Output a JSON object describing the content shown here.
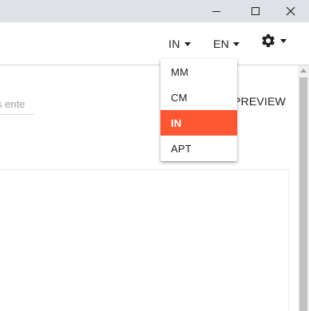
{
  "window": {
    "controls": [
      "minimize",
      "maximize",
      "close"
    ]
  },
  "header": {
    "unit_menu_label": "IN",
    "language_menu_label": "EN",
    "settings_icon": "gear-icon"
  },
  "toolbar": {
    "search_placeholder": "s ente",
    "preview_label": "PREVIEW"
  },
  "unit_dropdown": {
    "selected": "IN",
    "options": [
      {
        "label": "MM",
        "selected": false
      },
      {
        "label": "CM",
        "selected": false
      },
      {
        "label": "IN",
        "selected": true
      },
      {
        "label": "APT",
        "selected": false
      }
    ]
  },
  "colors": {
    "accent": "#ff5733",
    "titlebar": "#dee1e6"
  }
}
